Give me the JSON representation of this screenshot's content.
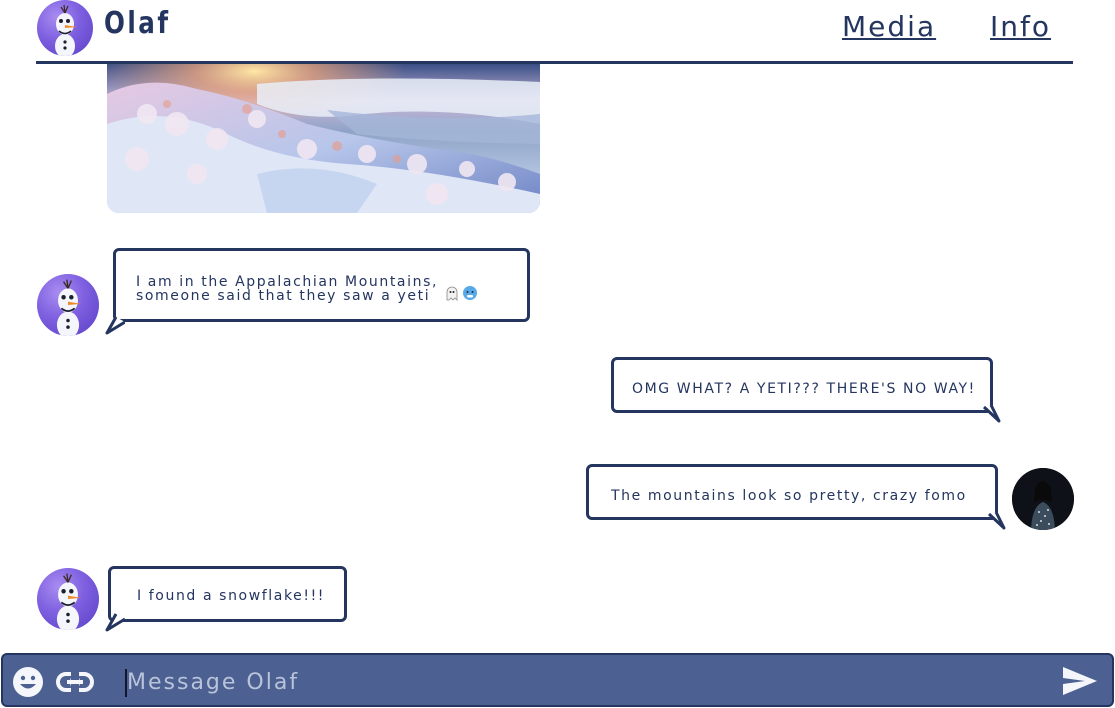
{
  "header": {
    "title": "Olaf",
    "nav": [
      "Media",
      "Info"
    ]
  },
  "messages": [
    {
      "from": "contact",
      "text": "I am in the Appalachian Mountains,",
      "text2": "someone said that they saw a yeti",
      "emoji": [
        "ghost",
        "cold-face"
      ]
    },
    {
      "from": "user",
      "text": "OMG WHAT? A YETI??? THERE'S NO WAY!"
    },
    {
      "from": "user",
      "text": "The mountains look so pretty, crazy fomo"
    },
    {
      "from": "contact",
      "text": "I found a snowflake!!!"
    }
  ],
  "composer": {
    "placeholder": "Message Olaf",
    "icons": [
      "emoji-icon",
      "link-icon",
      "send-icon"
    ]
  },
  "colors": {
    "ink": "#24355f",
    "composer_bg": "#4c6191",
    "avatar_purple": "#7d5fe0"
  }
}
